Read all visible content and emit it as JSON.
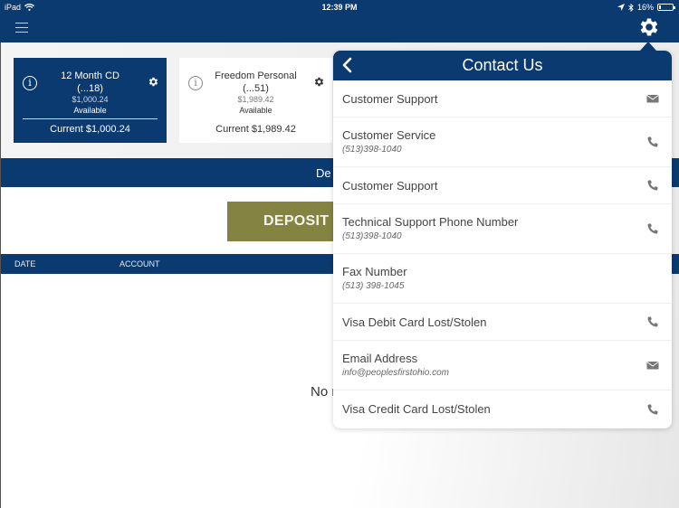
{
  "status_bar": {
    "device": "iPad",
    "time": "12:39 PM",
    "battery_percent_label": "16%",
    "battery_level": 0.16
  },
  "nav": {
    "menu_icon": "hamburger-menu-icon",
    "settings_icon": "gear-icon"
  },
  "accounts": [
    {
      "name": "12 Month CD",
      "number": "(...18)",
      "available_amount": "$1,000.24",
      "available_label": "Available",
      "current": "Current $1,000.24",
      "selected": true
    },
    {
      "name": "Freedom Personal",
      "number": "(...51)",
      "available_amount": "$1,989.42",
      "available_label": "Available",
      "current": "Current $1,989.42",
      "selected": false
    }
  ],
  "section_bar": {
    "label": "De"
  },
  "deposit_button": {
    "label": "DEPOSIT A"
  },
  "table": {
    "columns": [
      "DATE",
      "ACCOUNT"
    ]
  },
  "empty_message": "No r",
  "popover": {
    "title": "Contact Us",
    "back_icon": "chevron-left-icon",
    "items": [
      {
        "name": "Customer Support",
        "detail": "",
        "icon": "envelope-icon"
      },
      {
        "name": "Customer Service",
        "detail": "(513)398-1040",
        "icon": "phone-icon"
      },
      {
        "name": "Customer Support",
        "detail": "",
        "icon": "phone-icon"
      },
      {
        "name": "Technical Support Phone Number",
        "detail": "(513)398-1040",
        "icon": "phone-icon"
      },
      {
        "name": "Fax Number",
        "detail": "(513) 398-1045",
        "icon": ""
      },
      {
        "name": "Visa Debit Card Lost/Stolen",
        "detail": "",
        "icon": "phone-icon"
      },
      {
        "name": "Email Address",
        "detail": "info@peoplesfirstohio.com",
        "icon": "envelope-icon"
      },
      {
        "name": "Visa Credit Card Lost/Stolen",
        "detail": "",
        "icon": "phone-icon"
      }
    ]
  },
  "colors": {
    "brand_navy": "#0b3a70",
    "deposit_olive": "#848341",
    "icon_gray": "#777777"
  }
}
